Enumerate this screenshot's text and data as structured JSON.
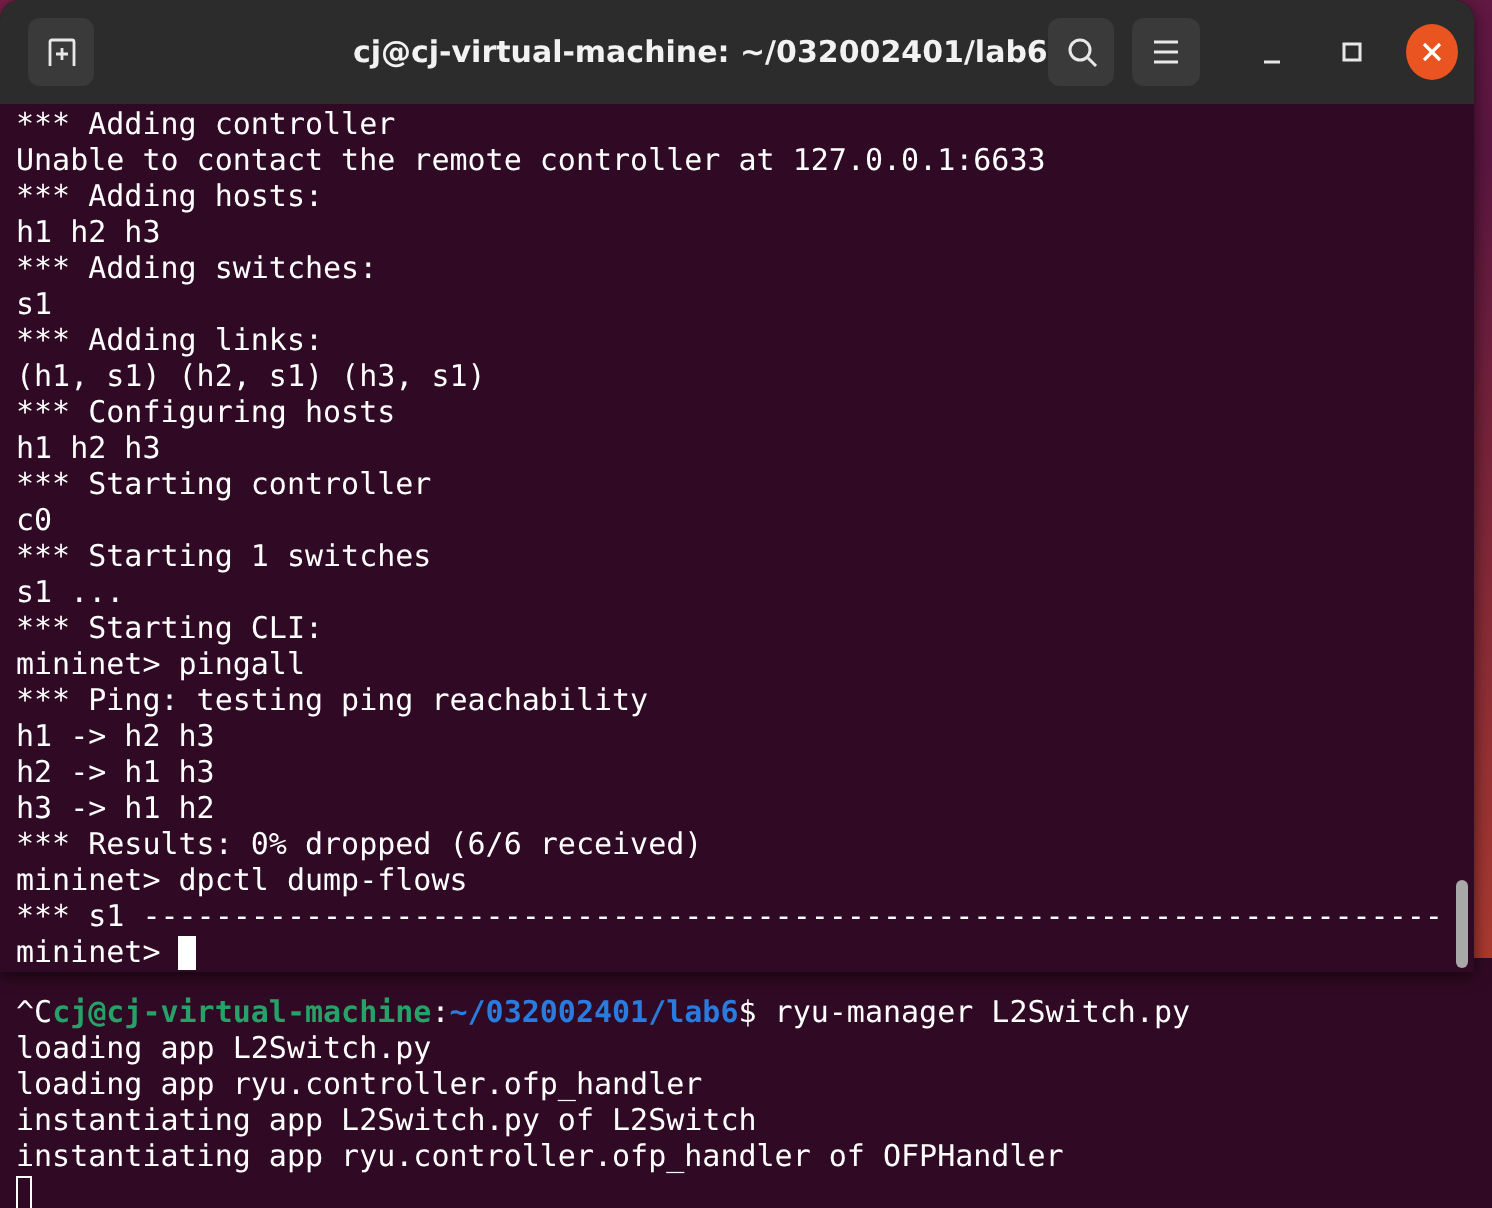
{
  "front_window": {
    "title": "cj@cj-virtual-machine: ~/032002401/lab6",
    "lines": [
      "*** Adding controller",
      "Unable to contact the remote controller at 127.0.0.1:6633",
      "*** Adding hosts:",
      "h1 h2 h3",
      "*** Adding switches:",
      "s1",
      "*** Adding links:",
      "(h1, s1) (h2, s1) (h3, s1)",
      "*** Configuring hosts",
      "h1 h2 h3",
      "*** Starting controller",
      "c0",
      "*** Starting 1 switches",
      "s1 ...",
      "*** Starting CLI:",
      "mininet> pingall",
      "*** Ping: testing ping reachability",
      "h1 -> h2 h3",
      "h2 -> h1 h3",
      "h3 -> h1 h2",
      "*** Results: 0% dropped (6/6 received)",
      "mininet> dpctl dump-flows",
      "*** s1 ------------------------------------------------------------------------",
      "mininet> "
    ]
  },
  "back_window": {
    "lines": [
      [
        {
          "kind": "plain",
          "text": "^C"
        },
        {
          "kind": "user",
          "text": "cj@cj-virtual-machine"
        },
        {
          "kind": "plain",
          "text": ":"
        },
        {
          "kind": "path",
          "text": "~/032002401/lab6"
        },
        {
          "kind": "plain",
          "text": "$ ryu-manager L2Switch.py"
        }
      ],
      [
        {
          "kind": "plain",
          "text": "loading app L2Switch.py"
        }
      ],
      [
        {
          "kind": "plain",
          "text": "loading app ryu.controller.ofp_handler"
        }
      ],
      [
        {
          "kind": "plain",
          "text": "instantiating app L2Switch.py of L2Switch"
        }
      ],
      [
        {
          "kind": "plain",
          "text": "instantiating app ryu.controller.ofp_handler of OFPHandler"
        }
      ]
    ]
  }
}
